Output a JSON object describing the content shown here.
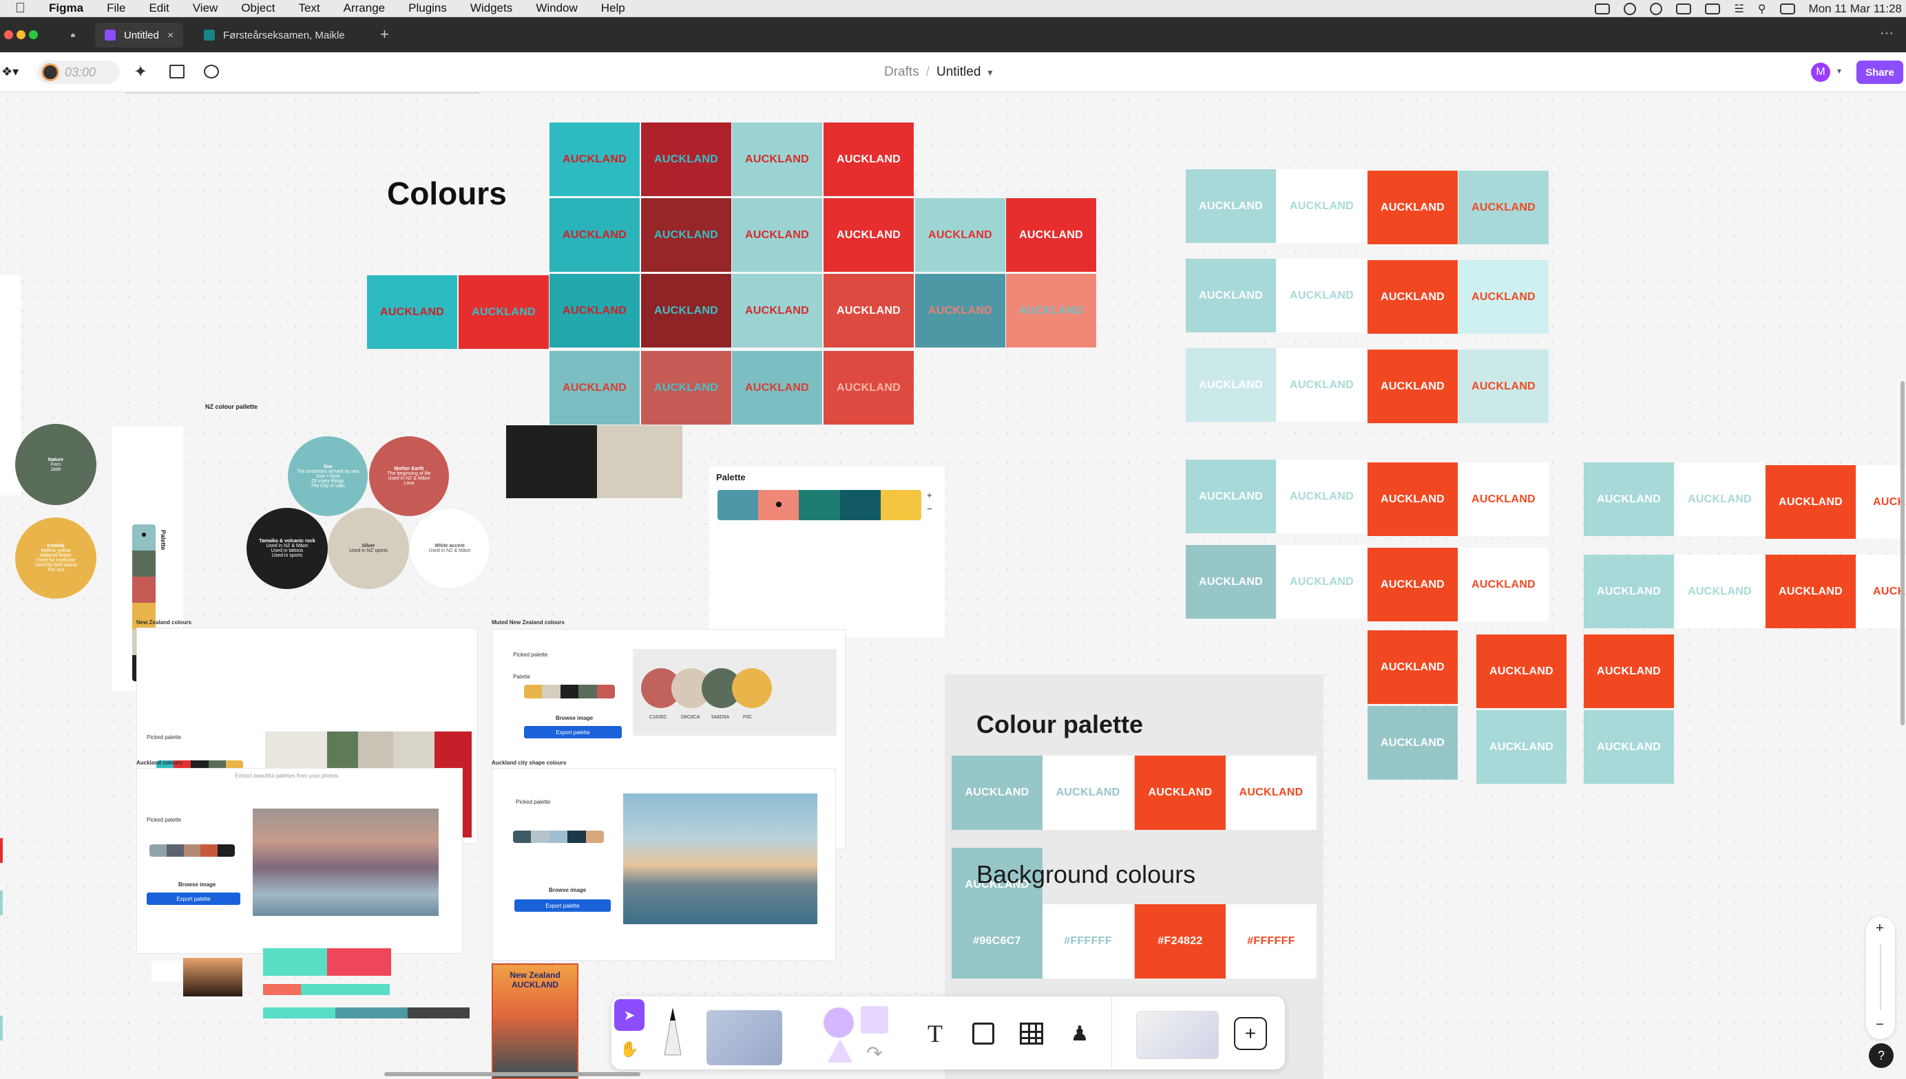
{
  "menubar": {
    "app": "Figma",
    "items": [
      "File",
      "Edit",
      "View",
      "Object",
      "Text",
      "Arrange",
      "Plugins",
      "Widgets",
      "Window",
      "Help"
    ],
    "clock": "Mon 11 Mar 11:28"
  },
  "tabs": {
    "home": "Home",
    "active": "Untitled",
    "second": "Førsteårseksamen, Maikle",
    "add": "+",
    "more": "···"
  },
  "toolbar": {
    "timer": "03:00",
    "breadcrumb_parent": "Drafts",
    "separator": "/",
    "file_title": "Untitled",
    "avatar": "M",
    "share": "Share"
  },
  "canvas": {
    "auckland": "AUCKLAND",
    "colours_title": "Colours",
    "nz_palette_title": "NZ colour pallette",
    "palette_label": "Palette",
    "palette_vertical_label": "Palette",
    "colour_palette_title": "Colour palette",
    "background_colours_title": "Background colours",
    "hex_codes": [
      "#96C6C7",
      "#FFFFFF",
      "#F24822",
      "#FFFFFF"
    ],
    "circles": [
      {
        "title": "Nature",
        "lines": [
          "Fern",
          "Jade"
        ]
      },
      {
        "title": "Kowhai",
        "lines": [
          "Mellow yellow",
          "National flower",
          "Used for medicine",
          "Used for bird sauna",
          "The sun"
        ]
      },
      {
        "title": "Sea",
        "lines": [
          "The ancestors arrived by sea",
          "Sea = food",
          "Of many things",
          "The City of sails"
        ]
      },
      {
        "title": "Mother Earth",
        "lines": [
          "The beginning of life",
          "Used in NZ & Māori",
          "Lava"
        ]
      },
      {
        "title": "Tamaiko & volcanic rock",
        "lines": [
          "Used in NZ & Māori",
          "Used in tattoos",
          "Used in sports"
        ]
      },
      {
        "title": "Silver",
        "lines": [
          "Used in NZ sports"
        ]
      },
      {
        "title": "White accent",
        "lines": [
          "Used in NZ & Māori"
        ]
      }
    ],
    "sections": [
      "New Zealand colours",
      "Muted New Zealand colours",
      "Auckland colours",
      "Auckland city shape colours"
    ],
    "picked_palette": "Picked palette",
    "palette_small": "Palette",
    "browse_image": "Browse image",
    "export_palette": "Export palette",
    "extract_text": "Extract beautiful palettes from your photos.",
    "hex_small": [
      "C1635C",
      "D8C8CA",
      "5A6D5A",
      "F0C"
    ],
    "poster_title": "New Zealand AUCKLAND",
    "palette_plus": "+",
    "palette_minus": "−"
  },
  "zoom": {
    "in": "+",
    "out": "−",
    "help": "?"
  },
  "colors": {
    "teal": "#2DBBC1",
    "red": "#E62E2E",
    "dark_red": "#9E2A2B",
    "light_teal": "#9BD3D3",
    "orange": "#F24822",
    "pale_teal": "#B9E1E0",
    "accent_purple": "#8C4DFF"
  }
}
